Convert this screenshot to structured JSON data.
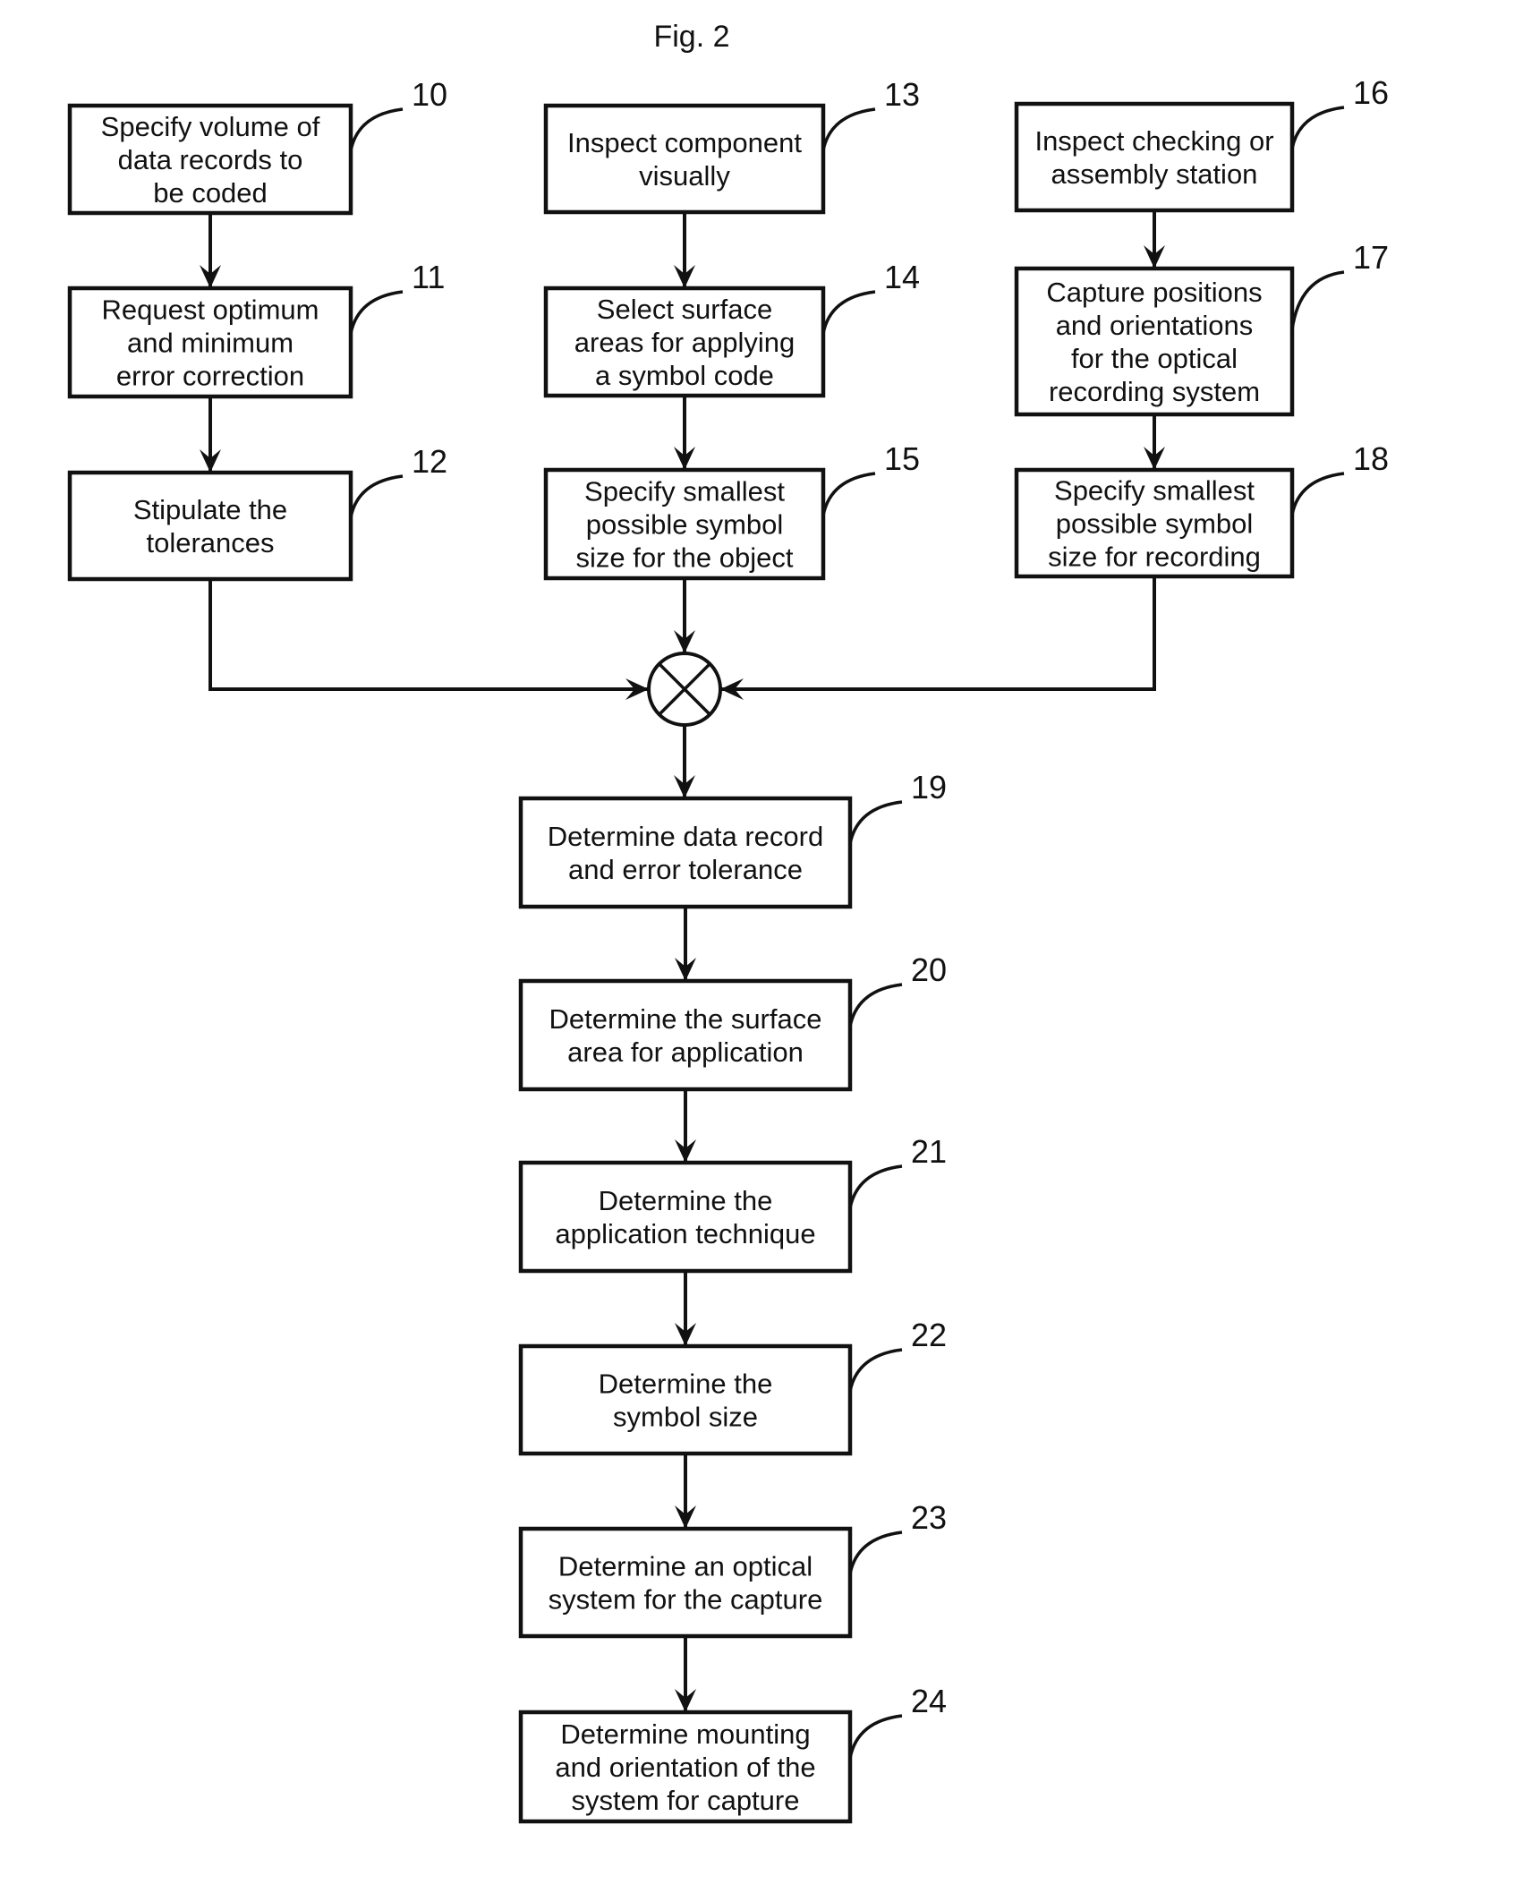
{
  "figure": {
    "title": "Fig. 2"
  },
  "colors": {
    "ink": "#111111",
    "paper": "#ffffff"
  },
  "steps": {
    "s10": {
      "ref": "10",
      "lines": [
        "Specify volume of",
        "data records to",
        "be coded"
      ]
    },
    "s11": {
      "ref": "11",
      "lines": [
        "Request optimum",
        "and minimum",
        "error correction"
      ]
    },
    "s12": {
      "ref": "12",
      "lines": [
        "Stipulate the",
        "tolerances"
      ]
    },
    "s13": {
      "ref": "13",
      "lines": [
        "Inspect component",
        "visually"
      ]
    },
    "s14": {
      "ref": "14",
      "lines": [
        "Select surface",
        "areas for applying",
        "a symbol code"
      ]
    },
    "s15": {
      "ref": "15",
      "lines": [
        "Specify smallest",
        "possible symbol",
        "size for the object"
      ]
    },
    "s16": {
      "ref": "16",
      "lines": [
        "Inspect checking or",
        "assembly station"
      ]
    },
    "s17": {
      "ref": "17",
      "lines": [
        "Capture positions",
        "and orientations",
        "for the optical",
        "recording system"
      ]
    },
    "s18": {
      "ref": "18",
      "lines": [
        "Specify smallest",
        "possible symbol",
        "size for recording"
      ]
    },
    "s19": {
      "ref": "19",
      "lines": [
        "Determine data record",
        "and error tolerance"
      ]
    },
    "s20": {
      "ref": "20",
      "lines": [
        "Determine the surface",
        "area for application"
      ]
    },
    "s21": {
      "ref": "21",
      "lines": [
        "Determine the",
        "application technique"
      ]
    },
    "s22": {
      "ref": "22",
      "lines": [
        "Determine the",
        "symbol size"
      ]
    },
    "s23": {
      "ref": "23",
      "lines": [
        "Determine an optical",
        "system for the capture"
      ]
    },
    "s24": {
      "ref": "24",
      "lines": [
        "Determine mounting",
        "and orientation of the",
        "system for capture"
      ]
    }
  },
  "merge_node": {
    "symbol": "combine-icon"
  }
}
